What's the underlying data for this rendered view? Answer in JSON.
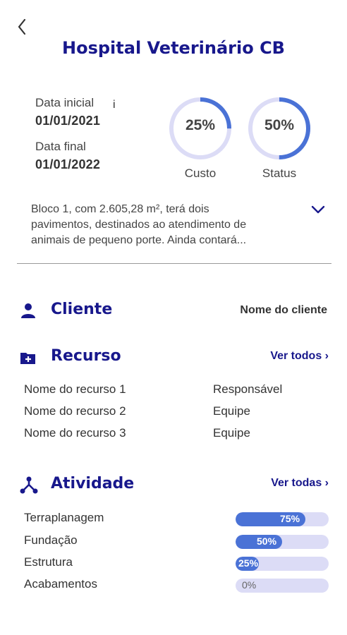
{
  "header": {
    "title": "Hospital Veterinário CB",
    "back_icon": "chevron-left-icon"
  },
  "dates": {
    "start_label": "Data inicial",
    "start_value": "01/01/2021",
    "end_label": "Data final",
    "end_value": "01/01/2022",
    "info_glyph": "i"
  },
  "gauges": [
    {
      "label": "Custo",
      "value_text": "25%",
      "fraction": 0.25
    },
    {
      "label": "Status",
      "value_text": "50%",
      "fraction": 0.5
    }
  ],
  "description": {
    "line1": "Bloco 1, com 2.605,28 m², terá dois",
    "line2": "pavimentos, destinados ao atendimento de",
    "line3": "animais de pequeno porte. Ainda contará..."
  },
  "cliente": {
    "title": "Cliente",
    "value": "Nome do cliente",
    "icon": "person-icon"
  },
  "recurso": {
    "title": "Recurso",
    "link": "Ver todos",
    "icon": "folder-plus-icon",
    "items": [
      {
        "name": "Nome do recurso 1",
        "role": "Responsável"
      },
      {
        "name": "Nome do recurso 2",
        "role": "Equipe"
      },
      {
        "name": "Nome do recurso 3",
        "role": "Equipe"
      }
    ]
  },
  "atividade": {
    "title": "Atividade",
    "link": "Ver todas",
    "icon": "network-icon",
    "items": [
      {
        "name": "Terraplanagem",
        "percent_text": "75%",
        "fraction": 0.75
      },
      {
        "name": "Fundação",
        "percent_text": "50%",
        "fraction": 0.5
      },
      {
        "name": "Estrutura",
        "percent_text": "25%",
        "fraction": 0.25
      },
      {
        "name": "Acabamentos",
        "percent_text": "0%",
        "fraction": 0
      }
    ]
  },
  "colors": {
    "primary": "#18188c",
    "accent": "#4a72d6",
    "track": "#dcdcf6"
  }
}
